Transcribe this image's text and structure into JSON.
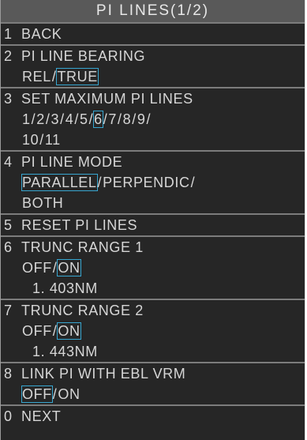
{
  "title": "PI LINES(1/2)",
  "items": {
    "back": {
      "num": "1",
      "label": "BACK"
    },
    "bearing": {
      "num": "2",
      "label": "PI LINE BEARING",
      "opt_rel": "REL",
      "opt_true": "TRUE",
      "sep": "/",
      "selected": "TRUE"
    },
    "maxlines": {
      "num": "3",
      "label": "SET MAXIMUM PI LINES",
      "opts": [
        "1",
        "2",
        "3",
        "4",
        "5",
        "6",
        "7",
        "8",
        "9",
        "10",
        "11"
      ],
      "sep": "/",
      "selected": "6"
    },
    "mode": {
      "num": "4",
      "label": "PI LINE MODE",
      "opt_parallel": "PARALLEL",
      "opt_perpendic": "PERPENDIC",
      "opt_both": "BOTH",
      "sep": "/",
      "selected": "PARALLEL"
    },
    "reset": {
      "num": "5",
      "label": "RESET PI LINES"
    },
    "trunc1": {
      "num": "6",
      "label": "TRUNC RANGE 1",
      "opt_off": "OFF",
      "opt_on": "ON",
      "sep": "/",
      "selected": "ON",
      "value": "1. 403NM"
    },
    "trunc2": {
      "num": "7",
      "label": "TRUNC RANGE 2",
      "opt_off": "OFF",
      "opt_on": "ON",
      "sep": "/",
      "selected": "ON",
      "value": "1. 443NM"
    },
    "link": {
      "num": "8",
      "label": "LINK PI WITH EBL VRM",
      "opt_off": "OFF",
      "opt_on": "ON",
      "sep": "/",
      "selected": "OFF"
    },
    "next": {
      "num": "0",
      "label": "NEXT"
    }
  },
  "colors": {
    "background": "#262626",
    "title_bar": "#595959",
    "text": "#d6d6d6",
    "divider": "#7c7c7c",
    "selection_border": "#37a6d0"
  }
}
